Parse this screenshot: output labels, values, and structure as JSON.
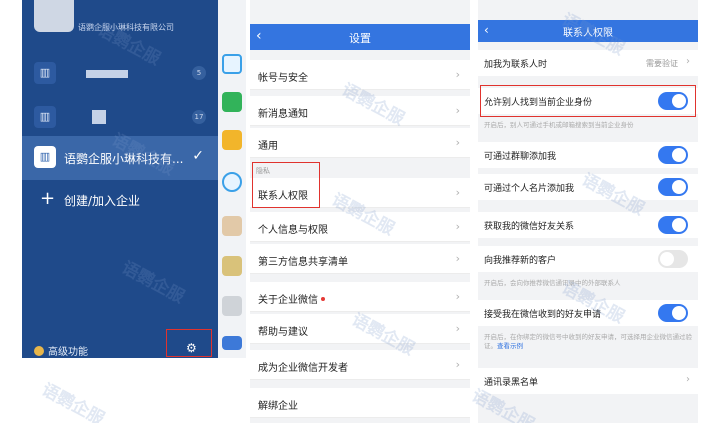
{
  "drawer": {
    "top_company": "语鹦企服小琳科技有限公司",
    "badges": [
      "5",
      "17"
    ],
    "active_company": "语鹦企服小琳科技有...",
    "create_join": "创建/加入企业",
    "advanced": "高级功能"
  },
  "settings": {
    "title": "设置",
    "items": {
      "account_security": "帐号与安全",
      "new_msg": "新消息通知",
      "general": "通用",
      "privacy_section": "隐私",
      "contact_perm": "联系人权限",
      "personal_info": "个人信息与权限",
      "third_party": "第三方信息共享清单",
      "about": "关于企业微信",
      "help": "帮助与建议",
      "developer": "成为企业微信开发者",
      "logout": "解绑企业"
    }
  },
  "permissions": {
    "title": "联系人权限",
    "add_as_contact": "加我为联系人时",
    "add_as_contact_value": "需要验证",
    "allow_find": "允许别人找到当前企业身份",
    "allow_find_note": "开启后，别人可通过手机或邮箱搜索到当前企业身份",
    "group_add": "可通过群聊添加我",
    "card_add": "可通过个人名片添加我",
    "wechat_friends": "获取我的微信好友关系",
    "recommend": "向我推荐新的客户",
    "recommend_note": "开启后，会向你推荐微信通讯录中的外部联系人",
    "accept_requests": "接受我在微信收到的好友申请",
    "accept_note": "开启后，在你绑定的微信号中收到的好友申请，可选择用企业微信通过验证。",
    "accept_note_link": "查看示例",
    "blacklist": "通讯录黑名单"
  },
  "watermark": "语鹦企服"
}
